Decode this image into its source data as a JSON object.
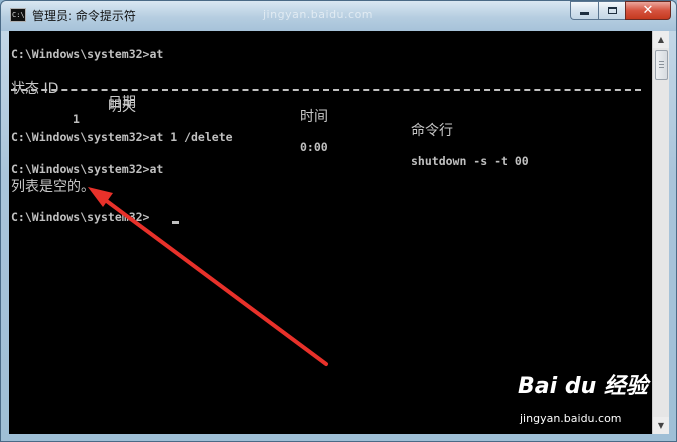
{
  "window": {
    "title": "管理员: 命令提示符",
    "app_icon_text": "C:\\.",
    "title_watermark": "jingyan.baidu.com"
  },
  "caption_buttons": {
    "minimize_icon": "minimize-icon",
    "maximize_icon": "maximize-icon",
    "close_label": "✕"
  },
  "console": {
    "lines": [
      "C:\\Windows\\system32>at",
      "",
      "",
      "C:\\Windows\\system32>at 1 /delete",
      "",
      "C:\\Windows\\system32>at",
      "列表是空的。",
      "",
      "C:\\Windows\\system32>"
    ],
    "table": {
      "headers": [
        "状态 ID",
        "日期",
        "时间",
        "命令行"
      ],
      "rows": [
        [
          "1",
          "明天",
          "0:00",
          "shutdown -s -t 00"
        ]
      ]
    }
  },
  "scrollbar": {
    "up_arrow": "▲",
    "down_arrow": "▼"
  },
  "watermark": {
    "brand": "Bai du 经验",
    "url": "jingyan.baidu.com"
  },
  "colors": {
    "console_bg": "#000000",
    "console_text": "#c0c0c0",
    "annotation_arrow": "#e8312a"
  }
}
